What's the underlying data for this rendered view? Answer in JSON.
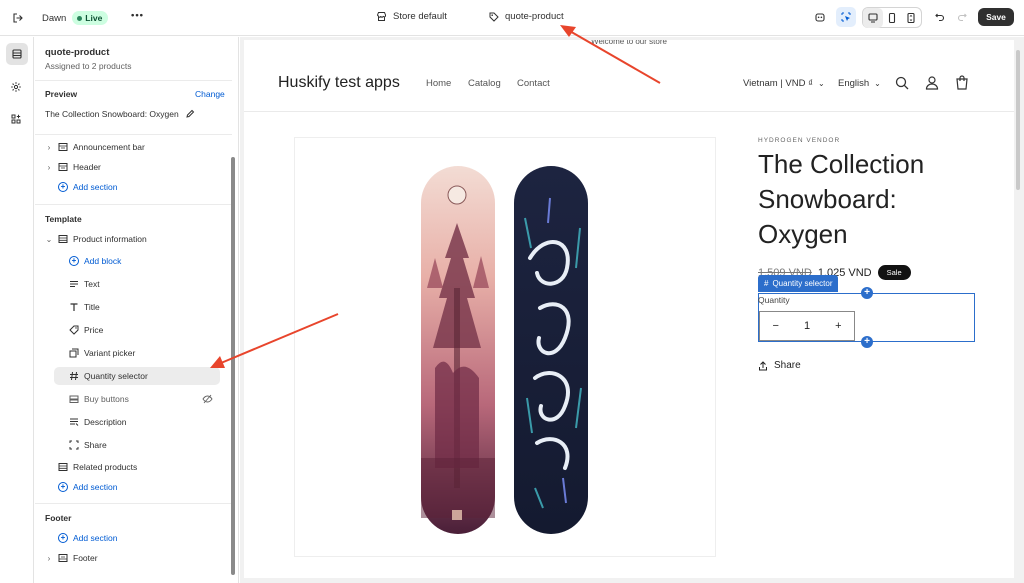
{
  "topbar": {
    "theme_name": "Dawn",
    "live_label": "Live",
    "more_label": "•••",
    "store_label": "Store default",
    "template_label": "quote-product",
    "save_label": "Save"
  },
  "panel": {
    "title": "quote-product",
    "subtitle": "Assigned to 2 products",
    "preview_label": "Preview",
    "change_label": "Change",
    "preview_product": "The Collection Snowboard: Oxygen",
    "header_group": [
      {
        "label": "Announcement bar",
        "icon": "section-icon"
      },
      {
        "label": "Header",
        "icon": "section-icon"
      }
    ],
    "add_section": "Add section",
    "template_heading": "Template",
    "product_information": "Product information",
    "add_block": "Add block",
    "blocks": [
      {
        "label": "Text",
        "icon": "text-lines-icon"
      },
      {
        "label": "Title",
        "icon": "title-t-icon"
      },
      {
        "label": "Price",
        "icon": "price-tag-icon"
      },
      {
        "label": "Variant picker",
        "icon": "variant-icon"
      },
      {
        "label": "Quantity selector",
        "icon": "hash-icon",
        "selected": true
      },
      {
        "label": "Buy buttons",
        "icon": "buy-buttons-icon",
        "hidden": true
      },
      {
        "label": "Description",
        "icon": "description-icon"
      },
      {
        "label": "Share",
        "icon": "share-frame-icon"
      }
    ],
    "related_products": "Related products",
    "footer_heading": "Footer",
    "footer_section": "Footer"
  },
  "site": {
    "announcement": "Welcome to our store",
    "store_name": "Huskify test apps",
    "nav": [
      "Home",
      "Catalog",
      "Contact"
    ],
    "currency": "Vietnam | VND ₫",
    "language": "English",
    "vendor": "HYDROGEN VENDOR",
    "product_title": "The Collection Snowboard: Oxygen",
    "old_price": "1.509 VND",
    "price": "1.025 VND",
    "sale_badge": "Sale",
    "qs_tag": "Quantity selector",
    "quantity_label": "Quantity",
    "quantity_value": "1",
    "share_label": "Share"
  },
  "colors": {
    "accent_blue": "#2c6ecb",
    "annotation_arrow": "#e8452c",
    "live_green": "#29845a"
  }
}
